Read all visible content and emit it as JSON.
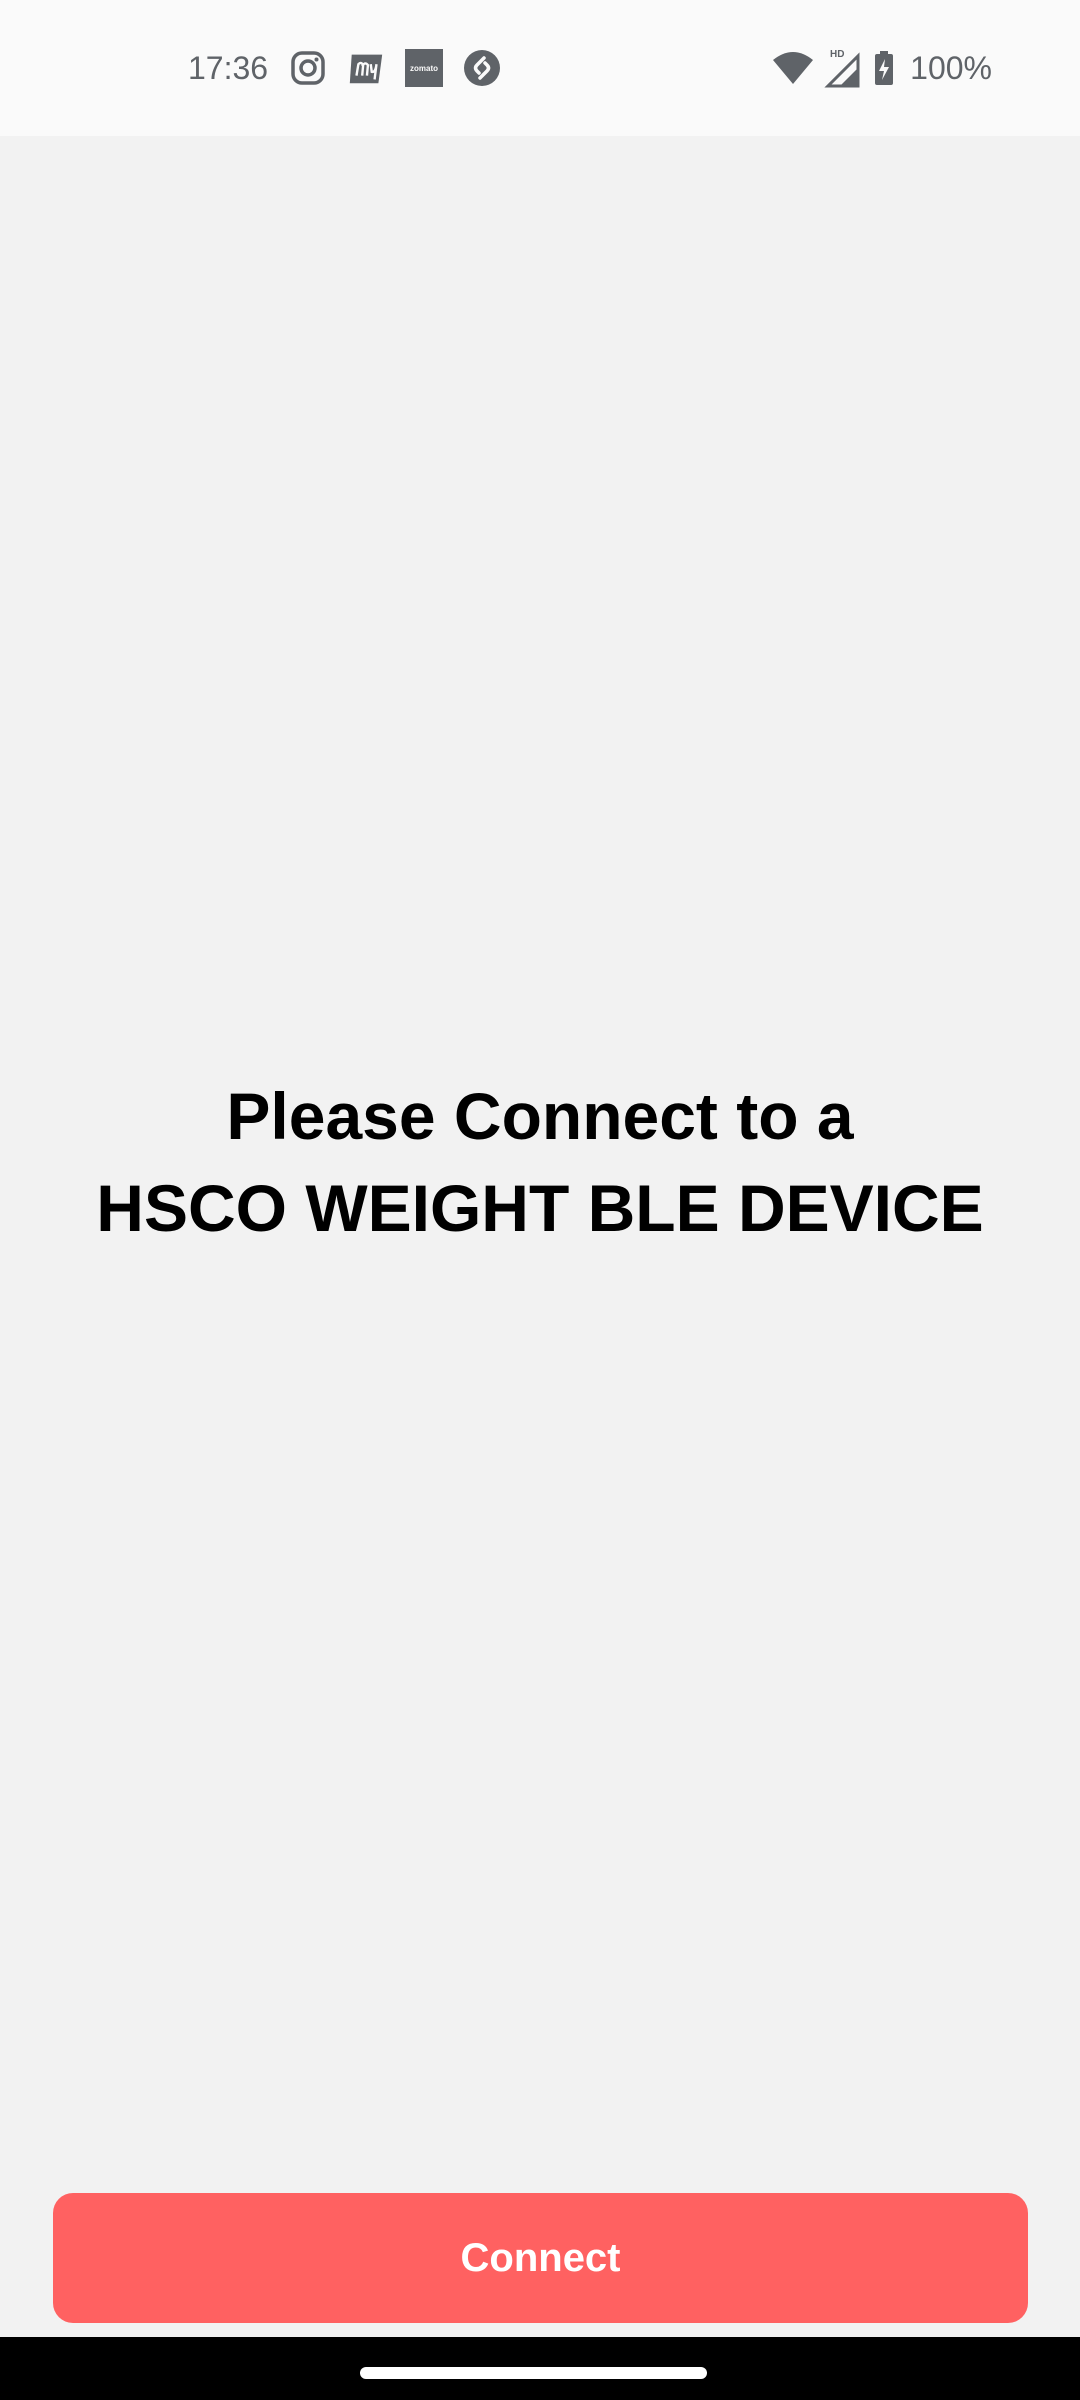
{
  "status_bar": {
    "time": "17:36",
    "notification_icons": [
      "instagram-icon",
      "myntra-icon",
      "zomato-icon",
      "shazam-icon"
    ],
    "zomato_text": "zomato",
    "signal_badge": "HD",
    "battery_percent": "100%"
  },
  "main": {
    "message_line1": "Please Connect to a",
    "message_line2": "HSCO WEIGHT BLE DEVICE"
  },
  "actions": {
    "connect_label": "Connect"
  },
  "colors": {
    "background": "#f2f2f2",
    "status_bar_bg": "#fafafa",
    "button": "#ff6161",
    "nav_bar": "#000000"
  }
}
